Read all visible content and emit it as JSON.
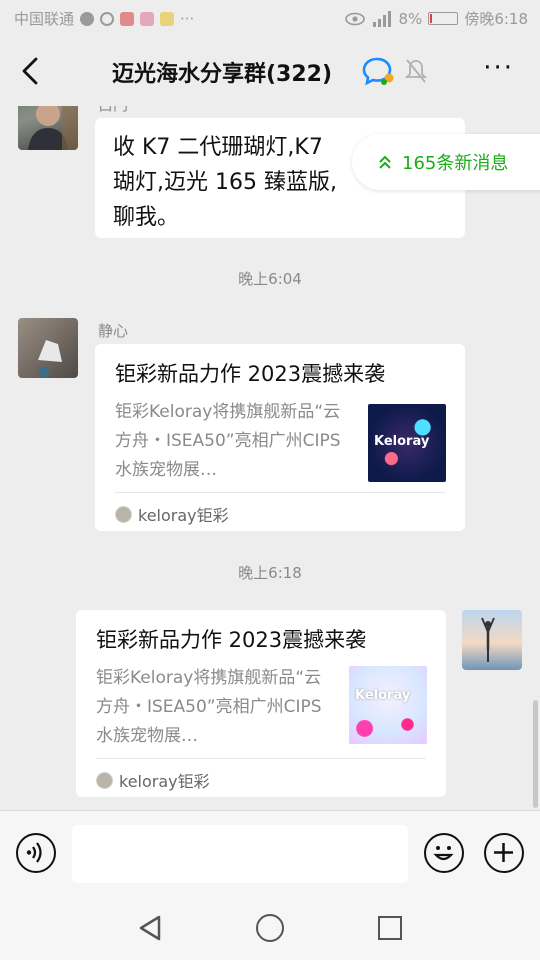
{
  "status_bar": {
    "carrier": "中国联通",
    "battery": "8%",
    "battery_level": 0.08,
    "time": "傍晚6:18",
    "overflow": "···"
  },
  "header": {
    "title": "迈光海水分享群(322)",
    "back_icon": "chevron-left-icon",
    "more_label": "···"
  },
  "new_messages": {
    "label": "165条新消息",
    "icon": "double-chevron-up-icon"
  },
  "messages": {
    "m1": {
      "sender": "白门",
      "text": "收 K7 二代珊瑚灯,K7 二代珊瑚灯,迈光 165 臻蓝版,聊我。",
      "lines": [
        "收 K7 二代珊瑚灯,K7",
        "瑚灯,迈光 165 臻蓝版,",
        "聊我。"
      ]
    },
    "t1": "晚上6:04",
    "m2": {
      "sender": "静心",
      "card_title": "钜彩新品力作 2023震撼来袭",
      "card_desc": "钜彩Keloray将携旗舰新品“云方舟・ISEA50”亮相广州CIPS水族宠物展…",
      "thumb_text": "Keloray",
      "source": "keloray钜彩"
    },
    "t2": "晚上6:18",
    "m3": {
      "card_title": "钜彩新品力作 2023震撼来袭",
      "card_desc": "钜彩Keloray将携旗舰新品“云方舟・ISEA50”亮相广州CIPS水族宠物展…",
      "thumb_text": "Keloray",
      "source": "keloray钜彩"
    }
  },
  "input_bar": {
    "placeholder": ""
  },
  "colors": {
    "accent_green": "#1aad19",
    "background": "#ededed",
    "bubble": "#ffffff"
  }
}
